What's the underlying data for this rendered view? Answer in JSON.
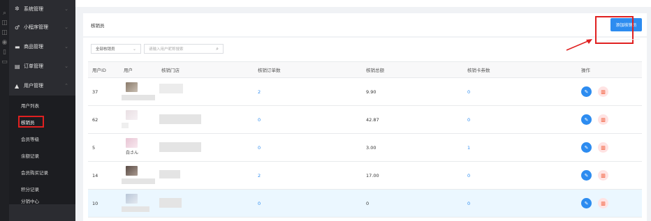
{
  "sidebar": {
    "groups": [
      {
        "label": "系统管理",
        "icon": "gear-icon",
        "glyph": "✲"
      },
      {
        "label": "小程序管理",
        "icon": "link-icon",
        "glyph": "♂"
      },
      {
        "label": "商品管理",
        "icon": "box-icon",
        "glyph": "▬"
      },
      {
        "label": "订单管理",
        "icon": "order-icon",
        "glyph": "▤"
      },
      {
        "label": "用户管理",
        "icon": "user-icon",
        "glyph": "▲"
      }
    ],
    "sub_items": [
      {
        "label": "用户列表"
      },
      {
        "label": "核销员"
      },
      {
        "label": "会员等级"
      },
      {
        "label": "余额记录"
      },
      {
        "label": "会员购买记录"
      },
      {
        "label": "积分记录"
      },
      {
        "label": "分销中心"
      }
    ]
  },
  "header": {
    "title": "核销员",
    "add_button": "添加核销员"
  },
  "filter": {
    "select_value": "全部核销员",
    "search_placeholder": "请输入用户昵称搜索"
  },
  "table": {
    "columns": [
      "用户ID",
      "用户",
      "核销门店",
      "核销订单数",
      "核销总额",
      "核销卡券数",
      "操作"
    ],
    "rows": [
      {
        "id": "37",
        "user": "",
        "orders": "2",
        "total": "9.90",
        "cards": "0"
      },
      {
        "id": "62",
        "user": "",
        "orders": "0",
        "total": "42.87",
        "cards": "0"
      },
      {
        "id": "5",
        "user": "白さん",
        "orders": "0",
        "total": "3.00",
        "cards": "1"
      },
      {
        "id": "14",
        "user": "",
        "orders": "2",
        "total": "17.00",
        "cards": "0"
      },
      {
        "id": "10",
        "user": "",
        "orders": "0",
        "total": "0",
        "cards": "0"
      }
    ]
  },
  "colors": {
    "accent": "#2d8cf0",
    "danger": "#ed4014",
    "annotation": "#e02020",
    "sidebar_bg": "#2b2c31"
  }
}
